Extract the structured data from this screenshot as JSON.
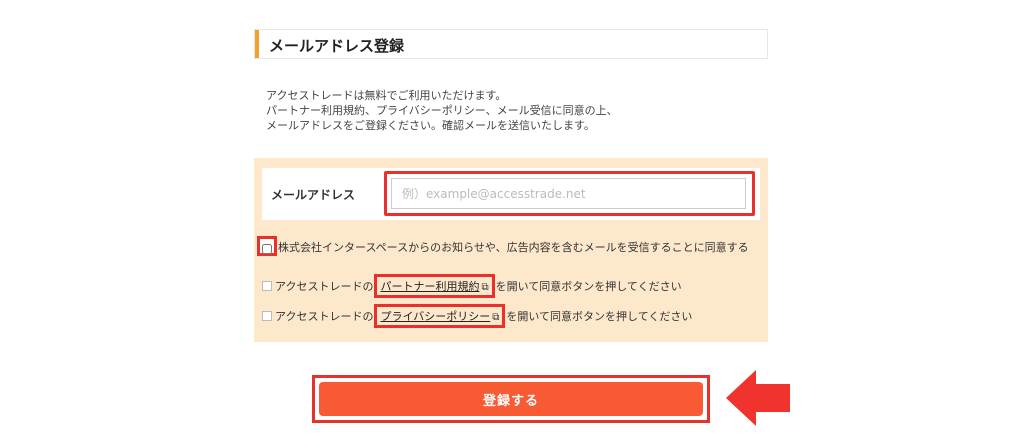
{
  "heading": {
    "title": "メールアドレス登録"
  },
  "description": {
    "line1": "アクセストレードは無料でご利用いただけます。",
    "line2": "パートナー利用規約、プライバシーポリシー、メール受信に同意の上、",
    "line3": "メールアドレスをご登録ください。確認メールを送信いたします。"
  },
  "form": {
    "email_label": "メールアドレス",
    "email_placeholder": "例）example@accesstrade.net",
    "email_value": "",
    "consent_checkbox_checked": false,
    "consent_text": "株式会社インタースペースからのお知らせや、広告内容を含むメールを受信することに同意する",
    "partner_row": {
      "prefix": "アクセストレードの",
      "link_text": "パートナー利用規約",
      "suffix": "を開いて同意ボタンを押してください"
    },
    "privacy_row": {
      "prefix": "アクセストレードの",
      "link_text": "プライバシーポリシー",
      "suffix": "を開いて同意ボタンを押してください"
    }
  },
  "submit": {
    "label": "登録する"
  },
  "colors": {
    "accent_orange": "#f5a02a",
    "panel_bg": "#fde8cc",
    "highlight_red": "#e8312c",
    "button_bg": "#f85a34"
  }
}
